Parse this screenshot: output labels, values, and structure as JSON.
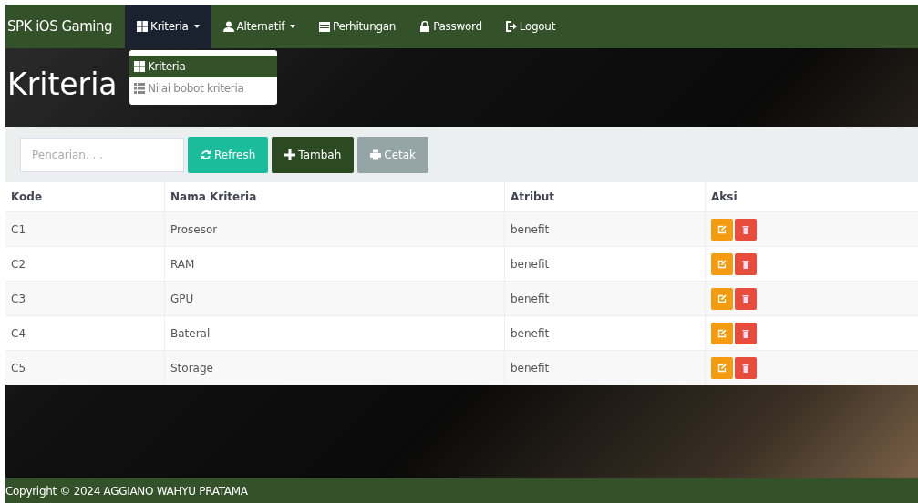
{
  "navbar": {
    "brand": "SPK iOS Gaming",
    "items": [
      {
        "label": "Kriteria",
        "dropdown": true,
        "selected": true
      },
      {
        "label": "Alternatif",
        "dropdown": true,
        "selected": false
      },
      {
        "label": "Perhitungan",
        "dropdown": false,
        "selected": false
      },
      {
        "label": "Password",
        "dropdown": false,
        "selected": false
      },
      {
        "label": "Logout",
        "dropdown": false,
        "selected": false
      }
    ]
  },
  "dropdown_menu": [
    {
      "label": "Kriteria",
      "selected": true
    },
    {
      "label": "Nilai bobot kriteria",
      "selected": false
    }
  ],
  "page_title": "Kriteria",
  "toolbar": {
    "search": {
      "placeholder": "Pencarian. . ."
    },
    "buttons": [
      {
        "label": "Refresh",
        "kind": "refresh"
      },
      {
        "label": "Tambah",
        "kind": "add"
      },
      {
        "label": "Cetak",
        "kind": "print"
      }
    ]
  },
  "table": {
    "columns": [
      "Kode",
      "Nama Kriteria",
      "Atribut",
      "Aksi"
    ],
    "rows": [
      {
        "kode": "C1",
        "nama": "Prosesor",
        "atribut": "benefit"
      },
      {
        "kode": "C2",
        "nama": "RAM",
        "atribut": "benefit"
      },
      {
        "kode": "C3",
        "nama": "GPU",
        "atribut": "benefit"
      },
      {
        "kode": "C4",
        "nama": "Bateral",
        "atribut": "benefit"
      },
      {
        "kode": "C5",
        "nama": "Storage",
        "atribut": "benefit"
      }
    ]
  },
  "footer": "Copyright © 2024 AGGIANO WAHYU PRATAMA"
}
